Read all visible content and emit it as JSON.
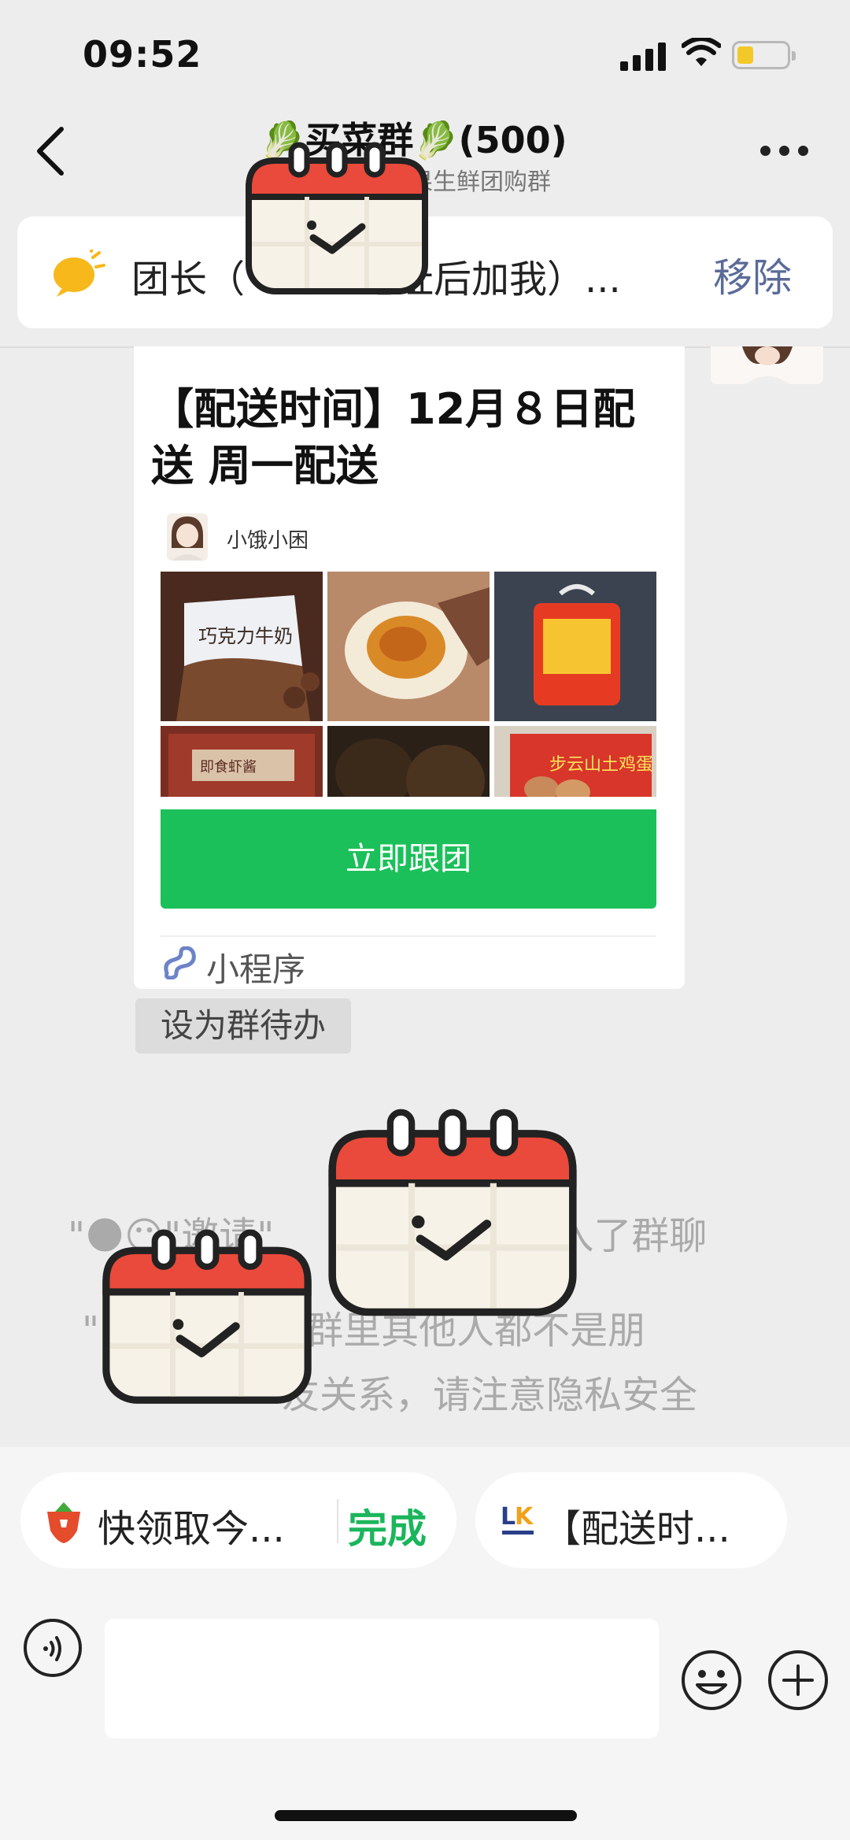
{
  "status_bar": {
    "time": "09:52"
  },
  "header": {
    "back_icon": "chevron-left-icon",
    "title": "🥬买菜群🥬(500)",
    "subtitle": "果生鲜团购群",
    "more_icon": "more-dots-icon"
  },
  "notice": {
    "icon": "megaphone-icon",
    "text": "团长（　　　地址后加我）...",
    "remove_label": "移除"
  },
  "card": {
    "title": "【配送时间】12月８日配送  周一配送",
    "author": "小饿小困",
    "images": [
      "巧克力牛奶",
      "咸鸭蛋",
      "米",
      "即食虾酱",
      "皮蛋",
      "步云山土鸡蛋"
    ],
    "join_label": "立即跟团",
    "source_label": "小程序",
    "source_icon": "mini-program-icon"
  },
  "todo_label": "设为群待办",
  "system_messages": [
    "\"🌑😶\"邀请\"　　　　　　\"加入了群聊",
    "\"　　　　\"与群里其他人都不是朋",
    "　　友关系，请注意隐私安全"
  ],
  "chips": [
    {
      "icon": "strawberry-icon",
      "text": "快领取今...",
      "action": "完成"
    },
    {
      "icon": "lk-logo-icon",
      "text": "【配送时..."
    }
  ],
  "input": {
    "placeholder": ""
  },
  "colors": {
    "accent_green": "#1bc05a",
    "link_blue": "#5a6b98",
    "sticker_red": "#e94a3b",
    "battery_yellow": "#f2c928"
  }
}
